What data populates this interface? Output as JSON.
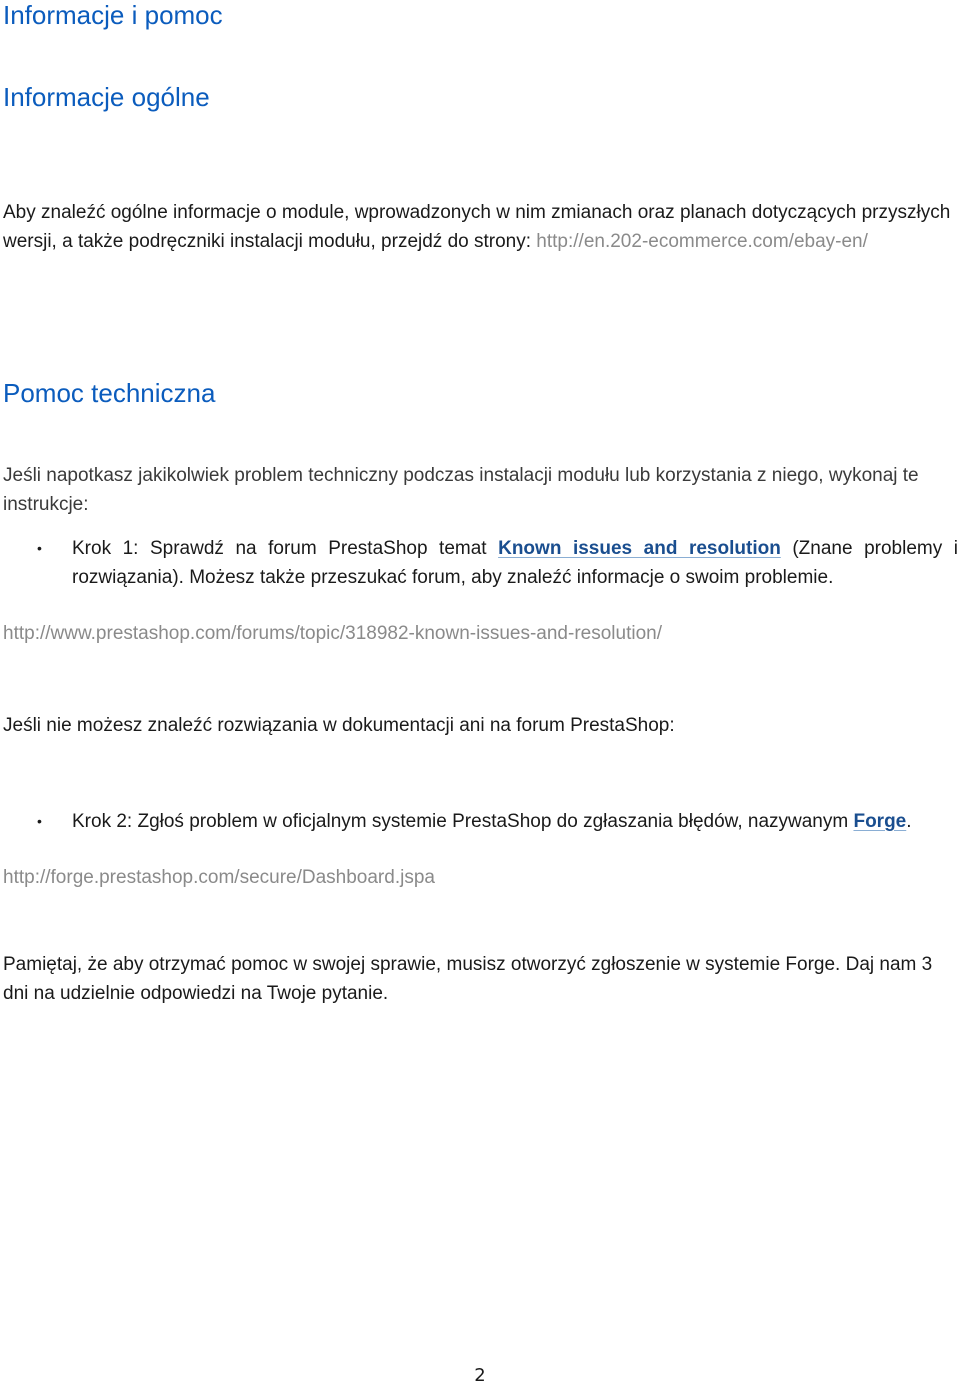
{
  "headings": {
    "main": "Informacje i pomoc",
    "general": "Informacje ogólne",
    "support": "Pomoc techniczna"
  },
  "general_section": {
    "text": "Aby znaleźć ogólne informacje o module, wprowadzonych w nim zmianach oraz planach dotyczących przyszłych wersji, a także podręczniki instalacji modułu, przejdź do strony: ",
    "url": "http://en.202-ecommerce.com/ebay-en/"
  },
  "support_section": {
    "intro": "Jeśli napotkasz jakikolwiek problem techniczny podczas instalacji modułu lub korzystania z niego, wykonaj te instrukcje:",
    "step1": {
      "before": "Krok 1: Sprawdź na forum PrestaShop temat ",
      "link": "Known issues and resolution",
      "after": " (Znane problemy i rozwiązania). Możesz także przeszukać forum, aby znaleźć informacje o swoim problemie."
    },
    "step1_url": "http://www.prestashop.com/forums/topic/318982-known-issues-and-resolution/",
    "no_solution": "Jeśli nie możesz znaleźć rozwiązania w dokumentacji ani na forum PrestaShop:",
    "step2": {
      "before": "Krok 2: Zgłoś problem w oficjalnym systemie PrestaShop do zgłaszania błędów, nazywanym ",
      "link": "Forge",
      "after": "."
    },
    "step2_url": "http://forge.prestashop.com/secure/Dashboard.jspa",
    "reminder": "Pamiętaj, że aby otrzymać pomoc w swojej sprawie, musisz otworzyć zgłoszenie w systemie Forge. Daj nam 3 dni na udzielnie odpowiedzi na Twoje pytanie."
  },
  "bullet_glyph": "•",
  "page_number": "2",
  "colors": {
    "heading": "#0b5cbd",
    "link": "#1a4e8f",
    "url_gray": "#8a8a8a"
  }
}
